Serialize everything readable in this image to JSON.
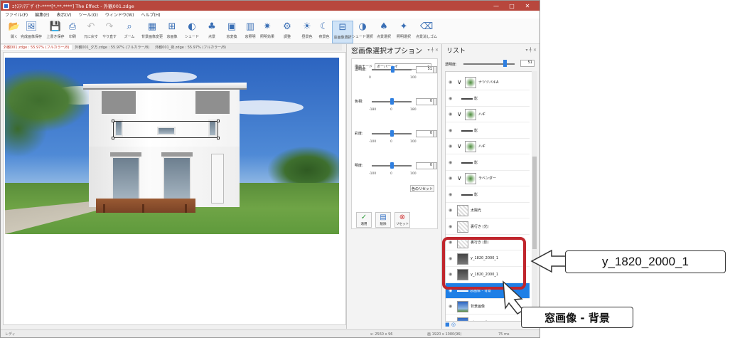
{
  "window": {
    "title": "ｴｸｽﾃﾘｱﾃﾞｻﾞｲﾅｰ****[*.**.****] The Effect - 外観001.zdge",
    "controls": [
      "—",
      "□",
      "✕"
    ]
  },
  "menu": [
    "ファイル(F)",
    "編集(E)",
    "表示(V)",
    "ツール(O)",
    "ウィンドウ(W)",
    "ヘルプ(H)"
  ],
  "toolbar": [
    {
      "label": "開く",
      "icon": "folder-icon"
    },
    {
      "label": "完成画像保存",
      "icon": "image-save-icon"
    },
    {
      "label": "上書き保存",
      "icon": "save-icon"
    },
    {
      "label": "印刷",
      "icon": "print-icon"
    },
    {
      "label": "元に戻す",
      "icon": "undo-icon"
    },
    {
      "label": "やり直す",
      "icon": "redo-icon"
    },
    {
      "label": "ズーム",
      "icon": "zoom-icon"
    },
    {
      "label": "背景画像変更",
      "icon": "background-icon"
    },
    {
      "label": "窓画像",
      "icon": "window-image-icon"
    },
    {
      "label": "シェード",
      "icon": "shade-icon"
    },
    {
      "label": "点景",
      "icon": "scenery-icon"
    },
    {
      "label": "窓変換",
      "icon": "window-convert-icon"
    },
    {
      "label": "窓照明",
      "icon": "window-light-icon"
    },
    {
      "label": "照明効果",
      "icon": "light-effect-icon"
    },
    {
      "label": "調整",
      "icon": "adjust-icon"
    },
    {
      "label": "昼景色",
      "icon": "daytime-icon"
    },
    {
      "label": "夜景色",
      "icon": "night-icon"
    },
    {
      "label": "窓画像選択",
      "icon": "window-select-icon"
    },
    {
      "label": "シェード選択",
      "icon": "shade-select-icon"
    },
    {
      "label": "点景選択",
      "icon": "scenery-select-icon"
    },
    {
      "label": "照明選択",
      "icon": "light-select-icon"
    },
    {
      "label": "点景消しゴム",
      "icon": "eraser-icon"
    }
  ],
  "doc_tabs": [
    "外観001.zdge : 55.97% (フルカラー/8)",
    "外観001_夕方.zdge : 55.97% (フルカラー/8)",
    "外観001_夜.zdge : 55.97% (フルカラー/8)"
  ],
  "options_panel": {
    "title": "窓画像選択オプション",
    "pin": "▾ ╃ ✕",
    "blend_mode_label": "描画モード",
    "blend_mode_value": "オーバーレイ",
    "sliders": [
      {
        "label": "透明度:",
        "value": "51",
        "min": "0",
        "max": "100",
        "fraction": 0.51
      },
      {
        "label": "色相:",
        "value": "0",
        "min": "-180",
        "mid": "0",
        "max": "180",
        "fraction": 0.5
      },
      {
        "label": "彩度:",
        "value": "0",
        "min": "-100",
        "mid": "0",
        "max": "100",
        "fraction": 0.5
      },
      {
        "label": "明度:",
        "value": "0",
        "min": "-100",
        "mid": "0",
        "max": "100",
        "fraction": 0.5
      }
    ],
    "reset_color_label": "色のリセット",
    "actions": [
      {
        "label": "適用",
        "icon": "check-icon"
      },
      {
        "label": "削除",
        "icon": "delete-icon"
      },
      {
        "label": "リセット",
        "icon": "reset-icon"
      }
    ]
  },
  "list_panel": {
    "title": "リスト",
    "pin": "▾ ╃ ✕",
    "opacity_label": "透明度:",
    "opacity_value": "51",
    "opacity_fraction": 0.8,
    "layers": [
      {
        "name": "ナツツバキA",
        "kind": "group",
        "thumb": "plant"
      },
      {
        "name": "影",
        "kind": "line"
      },
      {
        "name": "ハギ",
        "kind": "group",
        "thumb": "plant"
      },
      {
        "name": "影",
        "kind": "line"
      },
      {
        "name": "ハギ",
        "kind": "group",
        "thumb": "plant"
      },
      {
        "name": "影",
        "kind": "line"
      },
      {
        "name": "ラベンダー",
        "kind": "group",
        "thumb": "plant"
      },
      {
        "name": "影",
        "kind": "line"
      },
      {
        "name": "太陽光",
        "kind": "item",
        "thumb": "plain"
      },
      {
        "name": "裏行き (光)",
        "kind": "item",
        "thumb": "plain"
      },
      {
        "name": "裏行き (影)",
        "kind": "item",
        "thumb": "plain"
      },
      {
        "name": "y_1820_2000_1",
        "kind": "item",
        "thumb": "dark"
      },
      {
        "name": "y_1820_2000_1",
        "kind": "item",
        "thumb": "dark"
      },
      {
        "name": "窓画像 - 背景",
        "kind": "line",
        "selected": true
      },
      {
        "name": "背景画像",
        "kind": "item",
        "thumb": "sky"
      },
      {
        "name": "パース画像",
        "kind": "item",
        "thumb": "sky"
      }
    ]
  },
  "status": {
    "left": "レディ",
    "mid": "x: 2560 x 96",
    "right": "画 1920 x 1080(96)",
    "zoom": "75 ms"
  },
  "callouts": {
    "layer_name": "y_1820_2000_1",
    "selected_name": "窓画像 - 背景"
  }
}
